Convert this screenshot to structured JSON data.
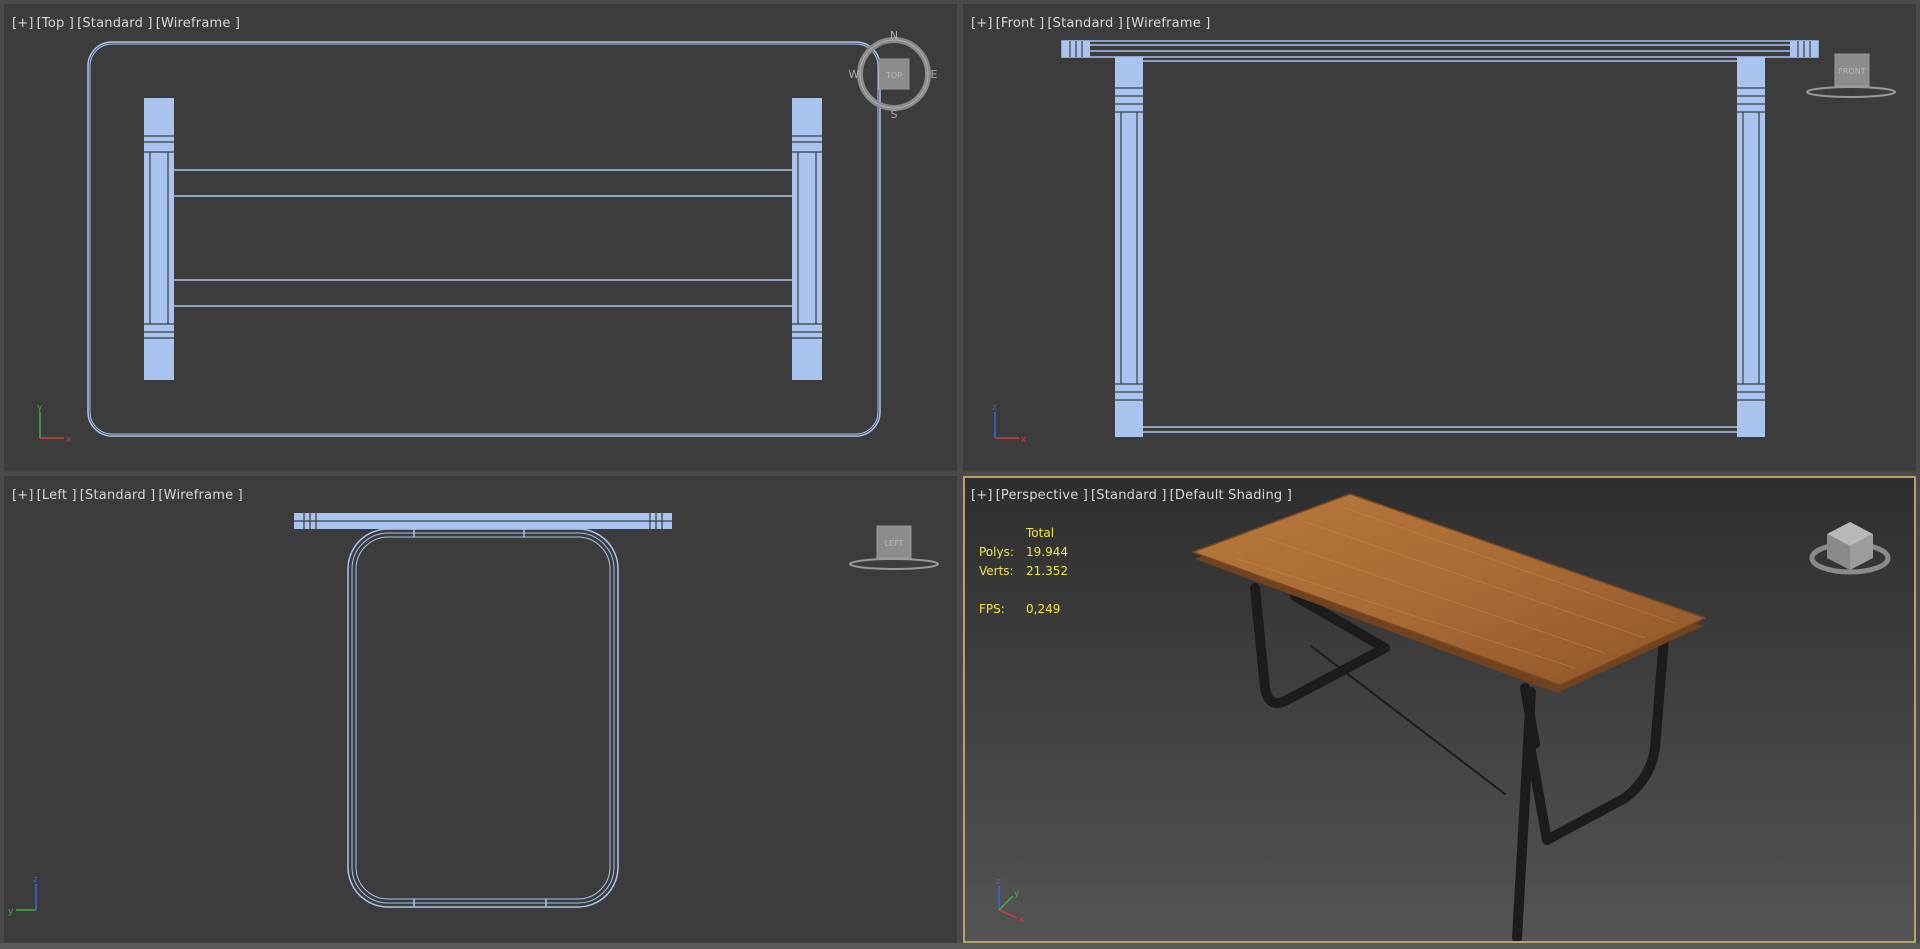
{
  "viewports": {
    "top": {
      "labels": [
        "[+]",
        "[Top ]",
        "[Standard ]",
        "[Wireframe ]"
      ],
      "compass": {
        "n": "N",
        "s": "S",
        "e": "E",
        "w": "W",
        "cube": "TOP"
      }
    },
    "front": {
      "labels": [
        "[+]",
        "[Front ]",
        "[Standard ]",
        "[Wireframe ]"
      ],
      "cube": "FRONT"
    },
    "left": {
      "labels": [
        "[+]",
        "[Left ]",
        "[Standard ]",
        "[Wireframe ]"
      ],
      "cube": "LEFT"
    },
    "perspective": {
      "labels": [
        "[+]",
        "[Perspective ]",
        "[Standard ]",
        "[Default Shading ]"
      ],
      "stats": {
        "total": "Total",
        "polys_label": "Polys:",
        "polys": "19.944",
        "verts_label": "Verts:",
        "verts": "21.352",
        "fps_label": "FPS:",
        "fps": "0,249"
      }
    }
  },
  "axes": {
    "x": "x",
    "y": "y",
    "z": "z"
  },
  "colors": {
    "wire": "#a9c5ef",
    "viewport_bg": "#3c3c3c",
    "active_border": "#b6a26a",
    "stats_text": "#f2e64a",
    "wood": "#a86b35"
  }
}
